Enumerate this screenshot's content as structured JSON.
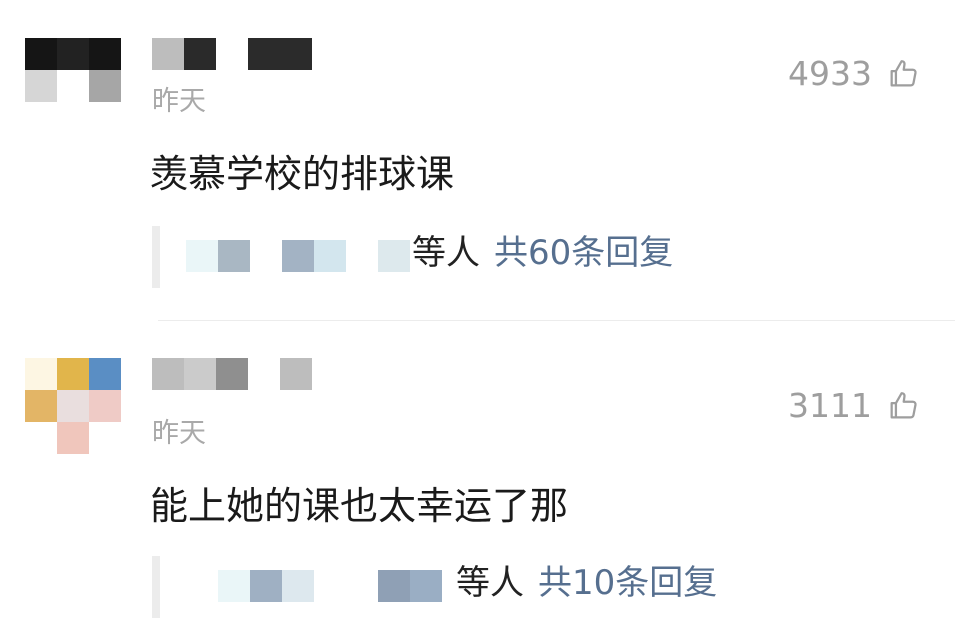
{
  "comments": [
    {
      "time": "昨天",
      "likes": "4933",
      "text": "羡慕学校的排球课",
      "reply_suffix": "等人",
      "reply_count": "共60条回复"
    },
    {
      "time": "昨天",
      "likes": "3111",
      "text": "能上她的课也太幸运了那",
      "reply_suffix": "等人",
      "reply_count": "共10条回复"
    }
  ],
  "colors": {
    "accent_link": "#566f8f",
    "muted_text": "#9e9e9e",
    "body_text": "#1a1a1a"
  },
  "icons": {
    "like": "thumbs-up-outline-icon"
  }
}
